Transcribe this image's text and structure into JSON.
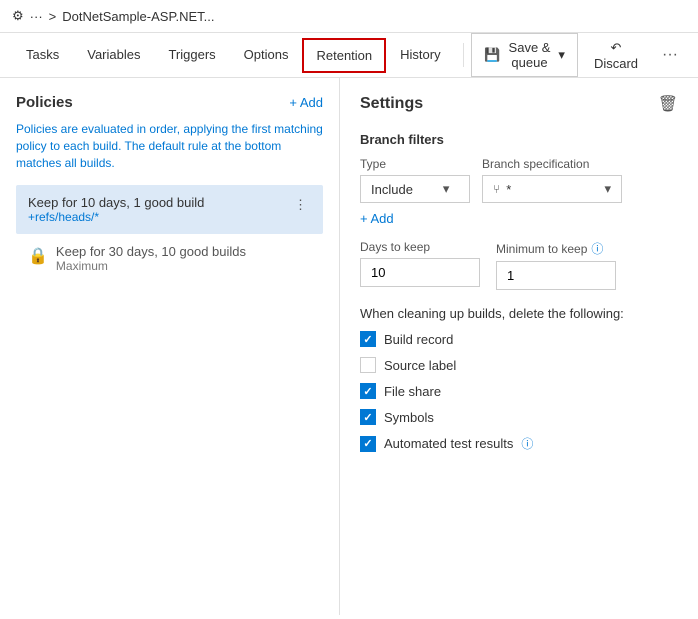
{
  "header": {
    "icon": "⚙",
    "dots": "···",
    "separator": ">",
    "title": "DotNetSample-ASP.NET..."
  },
  "nav": {
    "tabs": [
      {
        "id": "tasks",
        "label": "Tasks",
        "active": false
      },
      {
        "id": "variables",
        "label": "Variables",
        "active": false
      },
      {
        "id": "triggers",
        "label": "Triggers",
        "active": false
      },
      {
        "id": "options",
        "label": "Options",
        "active": false
      },
      {
        "id": "retention",
        "label": "Retention",
        "active": true
      },
      {
        "id": "history",
        "label": "History",
        "active": false
      }
    ],
    "save_queue_label": "Save & queue",
    "discard_label": "Discard"
  },
  "left": {
    "title": "Policies",
    "add_label": "+ Add",
    "description": "Policies are evaluated in order, applying the first matching policy to each build. The default rule at the bottom matches all builds.",
    "items": [
      {
        "id": "item1",
        "name": "Keep for 10 days, 1 good build",
        "sub": "+refs/heads/*",
        "selected": true,
        "locked": false
      },
      {
        "id": "item2",
        "name": "Keep for 30 days, 10 good builds",
        "sub": "Maximum",
        "selected": false,
        "locked": true
      }
    ]
  },
  "right": {
    "title": "Settings",
    "delete_icon": "🗑",
    "branch_filters": {
      "title": "Branch filters",
      "type_label": "Type",
      "type_value": "Include",
      "branch_label": "Branch specification",
      "branch_value": "*",
      "branch_icon": "⑂",
      "add_label": "+ Add"
    },
    "days_to_keep": {
      "label": "Days to keep",
      "value": "10"
    },
    "minimum_to_keep": {
      "label": "Minimum to keep",
      "value": "1"
    },
    "cleanup_label": "When cleaning up builds, delete the following:",
    "checkboxes": [
      {
        "id": "build_record",
        "label": "Build record",
        "checked": true
      },
      {
        "id": "source_label",
        "label": "Source label",
        "checked": false
      },
      {
        "id": "file_share",
        "label": "File share",
        "checked": true
      },
      {
        "id": "symbols",
        "label": "Symbols",
        "checked": true
      },
      {
        "id": "automated_test",
        "label": "Automated test results",
        "checked": true,
        "has_info": true
      }
    ]
  }
}
